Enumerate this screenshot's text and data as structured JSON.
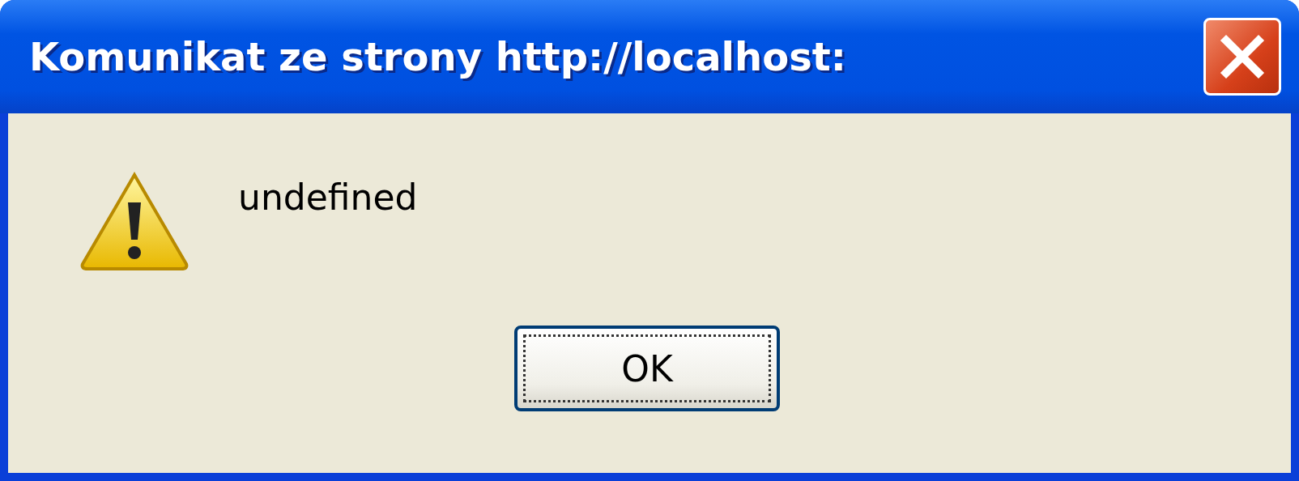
{
  "window": {
    "title": "Komunikat ze strony http://localhost:"
  },
  "message": {
    "kind": "warning",
    "text": "undefined"
  },
  "buttons": [
    {
      "label": "OK",
      "focused": true
    }
  ]
}
